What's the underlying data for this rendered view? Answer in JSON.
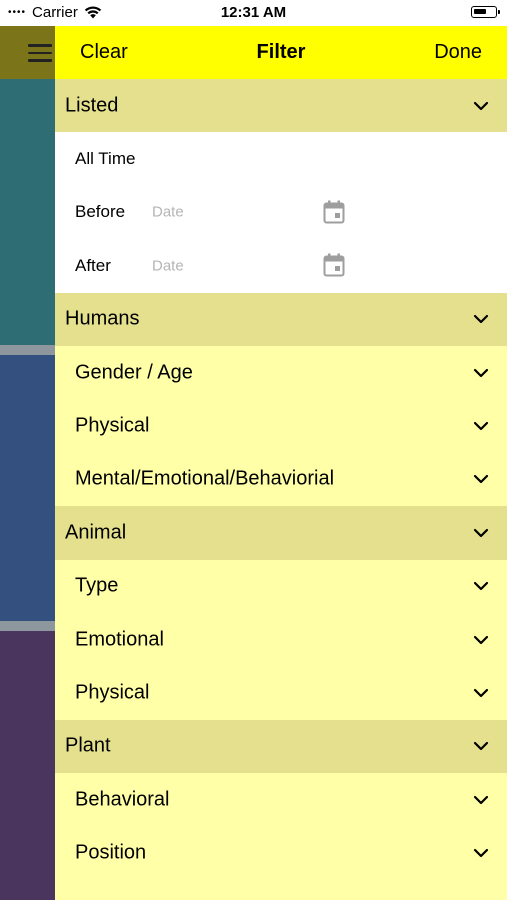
{
  "status": {
    "carrier": "Carrier",
    "time": "12:31 AM"
  },
  "header": {
    "clear_label": "Clear",
    "title": "Filter",
    "done_label": "Done"
  },
  "listed": {
    "label": "Listed",
    "all_time": "All Time",
    "before": {
      "label": "Before",
      "placeholder": "Date"
    },
    "after": {
      "label": "After",
      "placeholder": "Date"
    }
  },
  "humans": {
    "label": "Humans",
    "items": [
      "Gender / Age",
      "Physical",
      "Mental/Emotional/Behaviorial"
    ]
  },
  "animal": {
    "label": "Animal",
    "items": [
      "Type",
      "Emotional",
      "Physical"
    ]
  },
  "plant": {
    "label": "Plant",
    "items": [
      "Behavioral",
      "Position"
    ]
  },
  "colors": {
    "nav": "#ffff00",
    "section": "#e4e08e",
    "item": "#ffffa8"
  }
}
